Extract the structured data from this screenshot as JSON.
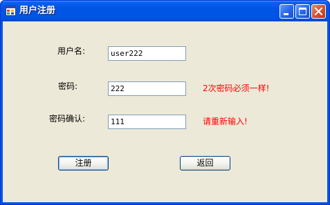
{
  "window": {
    "title": "用户注册",
    "icon": "app-window-icon"
  },
  "controls": {
    "minimize": "minimize-icon",
    "maximize": "maximize-icon",
    "close": "close-icon"
  },
  "form": {
    "username_label": "用户名:",
    "username_value": "user222",
    "password_label": "密码:",
    "password_value": "222",
    "password_note": "2次密码必须一样!",
    "confirm_label": "密码确认:",
    "confirm_value": "111",
    "confirm_note": "请重新输入!"
  },
  "buttons": {
    "register": "注册",
    "back": "返回"
  },
  "colors": {
    "titlebar": "#0054e3",
    "client_bg": "#ece9d8",
    "warning_text": "#ff0000",
    "close_button": "#d4502c"
  }
}
